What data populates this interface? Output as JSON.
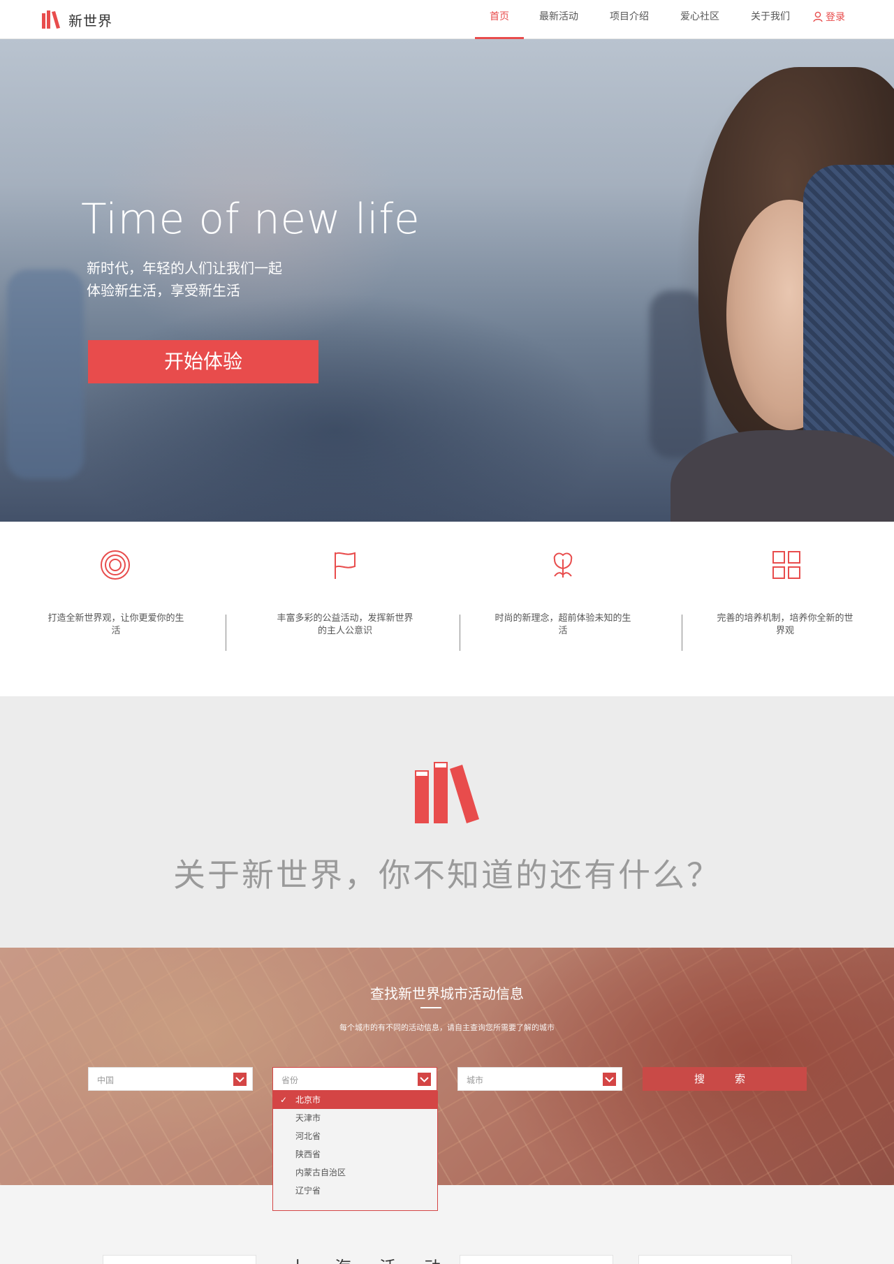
{
  "nav": {
    "brand": "新世界",
    "items": [
      {
        "label": "首页",
        "active": true
      },
      {
        "label": "最新活动",
        "active": false
      },
      {
        "label": "项目介绍",
        "active": false
      },
      {
        "label": "爱心社区",
        "active": false
      },
      {
        "label": "关于我们",
        "active": false
      }
    ],
    "login": "登录"
  },
  "hero": {
    "title": "Time of new life",
    "subtitle_line1": "新时代，年轻的人们让我们一起",
    "subtitle_line2": "体验新生活，享受新生活",
    "cta": "开始体验"
  },
  "features": [
    {
      "icon": "target-icon",
      "text": "打造全新世界观，让你更爱你的生活"
    },
    {
      "icon": "flag-icon",
      "text": "丰富多彩的公益活动，发挥新世界的主人公意识"
    },
    {
      "icon": "flower-icon",
      "text": "时尚的新理念，超前体验未知的生活"
    },
    {
      "icon": "grid-icon",
      "text": "完善的培养机制，培养你全新的世界观"
    }
  ],
  "about": {
    "question": "关于新世界，你不知道的还有什么？"
  },
  "search": {
    "title": "查找新世界城市活动信息",
    "description": "每个城市的有不同的活动信息，请自主查询您所需要了解的城市",
    "country_placeholder": "中国",
    "province_placeholder": "省份",
    "city_placeholder": "城市",
    "button": "搜　索",
    "province_options": [
      "北京市",
      "天津市",
      "河北省",
      "陕西省",
      "内蒙古自治区",
      "辽宁省"
    ],
    "selected_option": "北京市"
  },
  "bottom": {
    "title": "上海活动"
  },
  "colors": {
    "accent": "#e84c4c",
    "accent_dark": "#d44545",
    "about_bg": "#ececec"
  }
}
